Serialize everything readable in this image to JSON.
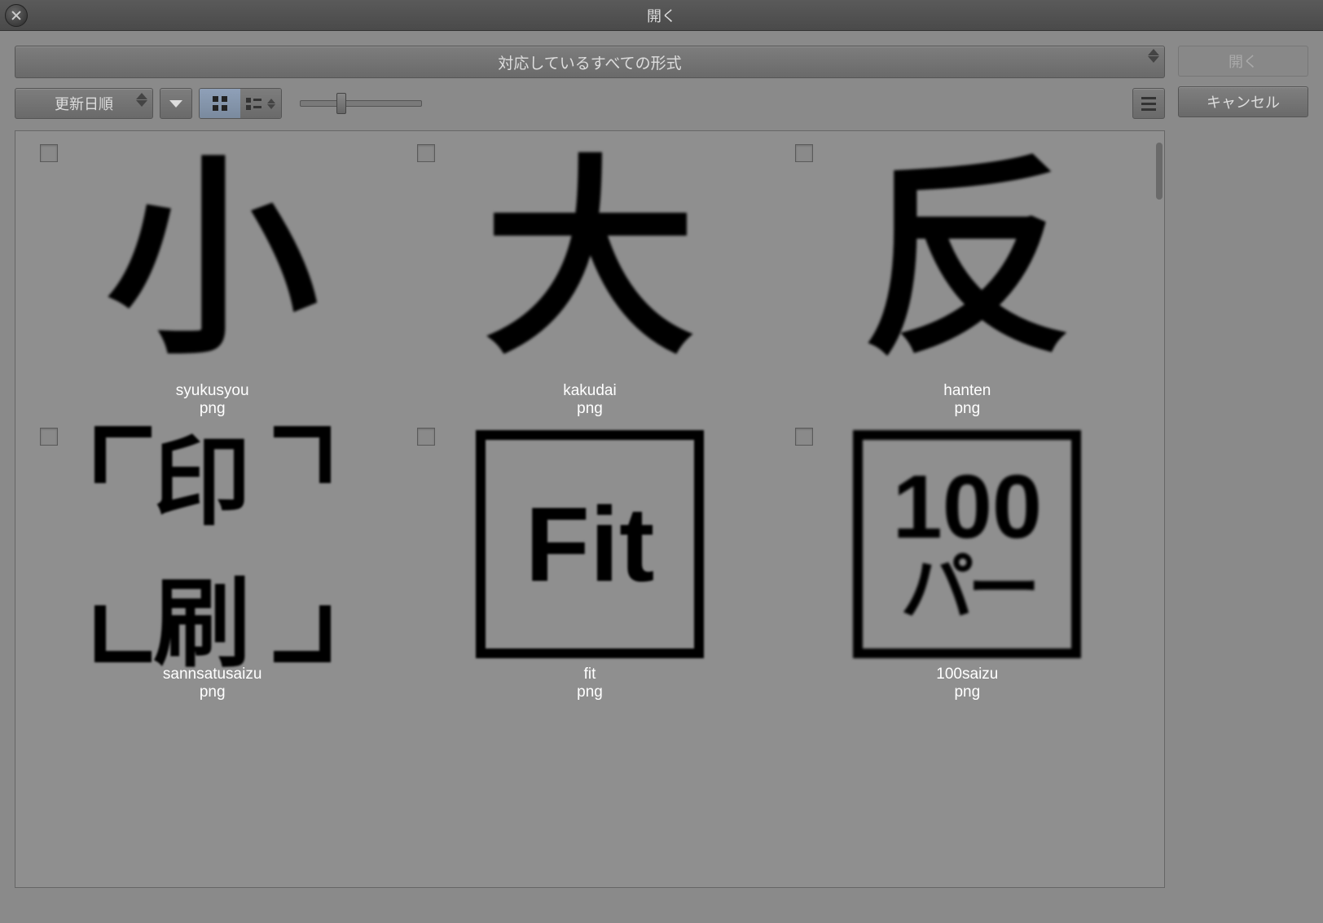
{
  "window": {
    "title": "開く"
  },
  "format_filter": {
    "selected": "対応しているすべての形式"
  },
  "actions": {
    "open_label": "開く",
    "cancel_label": "キャンセル"
  },
  "toolbar": {
    "sort_label": "更新日順"
  },
  "files": [
    {
      "name": "syukusyou",
      "ext": "png",
      "thumb_glyph": "小",
      "thumb_type": "glyph"
    },
    {
      "name": "kakudai",
      "ext": "png",
      "thumb_glyph": "大",
      "thumb_type": "glyph"
    },
    {
      "name": "hanten",
      "ext": "png",
      "thumb_glyph": "反",
      "thumb_type": "glyph"
    },
    {
      "name": "sannsatusaizu",
      "ext": "png",
      "thumb_glyph": "印刷",
      "thumb_type": "bracket"
    },
    {
      "name": "fit",
      "ext": "png",
      "thumb_glyph": "Fit",
      "thumb_type": "boxed"
    },
    {
      "name": "100saizu",
      "ext": "png",
      "thumb_line1": "100",
      "thumb_line2": "パー",
      "thumb_type": "hundred"
    }
  ]
}
